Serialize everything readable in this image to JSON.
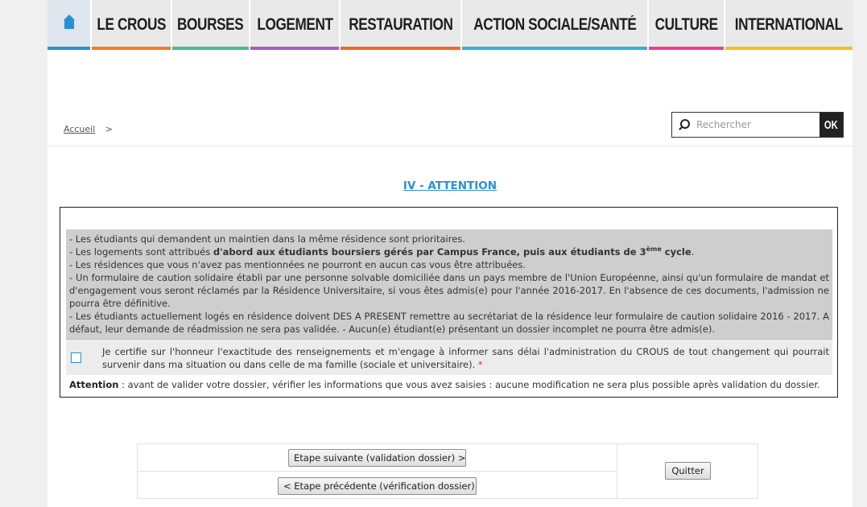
{
  "nav": {
    "home_icon": "home-icon",
    "items": [
      {
        "label": "LE CROUS",
        "color": "#f57c1f"
      },
      {
        "label": "BOURSES",
        "color": "#3fbf8f"
      },
      {
        "label": "LOGEMENT",
        "color": "#a45cc4"
      },
      {
        "label": "RESTAURATION",
        "color": "#f26a21"
      },
      {
        "label": "ACTION SOCIALE/SANTÉ",
        "color": "#2fb3d2"
      },
      {
        "label": "CULTURE",
        "color": "#ee3f8e"
      },
      {
        "label": "INTERNATIONAL",
        "color": "#f2c21b"
      }
    ],
    "home_color": "#2a8fd4"
  },
  "breadcrumb": {
    "home": "Accueil",
    "separator": ">"
  },
  "search": {
    "placeholder": "Rechercher",
    "button": "OK"
  },
  "section": {
    "title": "IV - ATTENTION"
  },
  "notes": {
    "line1": "- Les étudiants qui demandent un maintien dans la même résidence sont prioritaires.",
    "line2_pre": "- Les logements sont attribués ",
    "line2_bold": "d'abord aux étudiants boursiers gérés par Campus France, puis aux étudiants de 3",
    "line2_sup": "ème",
    "line2_bold_end": " cycle",
    "line2_end": ".",
    "line3": "- Les résidences que vous n'avez pas mentionnées ne pourront en aucun cas vous être attribuées.",
    "line4": "- Un formulaire de caution solidaire établi par une personne solvable domiciliée dans un pays membre de l'Union Européenne, ainsi qu'un formulaire de mandat et d'engagement vous seront réclamés par la Résidence Universitaire, si vous êtes admis(e) pour l'année 2016-2017. En l'absence de ces documents, l'admission ne pourra être définitive.",
    "line5": "- Les étudiants actuellement logés en résidence doivent DES A PRESENT remettre au secrétariat de la résidence leur formulaire de caution solidaire 2016 - 2017. A défaut, leur demande de réadmission ne sera pas validée. - Aucun(e) étudiant(e) présentant un dossier incomplet ne pourra être admis(e)."
  },
  "certification": {
    "text": "Je certifie sur l'honneur l'exactitude des renseignements et m'engage à informer sans délai l'administration du CROUS de tout changement qui pourrait survenir dans ma situation ou dans celle de ma famille (sociale et universitaire).",
    "required": "*",
    "checked": false
  },
  "attention_note": {
    "label": "Attention",
    "text": " : avant de valider votre dossier, vérifier les informations que vous avez saisies : aucune modification ne sera plus possible après validation du dossier."
  },
  "actions": {
    "next": "Etape suivante (validation dossier) >",
    "previous": "< Etape précédente (vérification dossier)",
    "quit": "Quitter"
  }
}
